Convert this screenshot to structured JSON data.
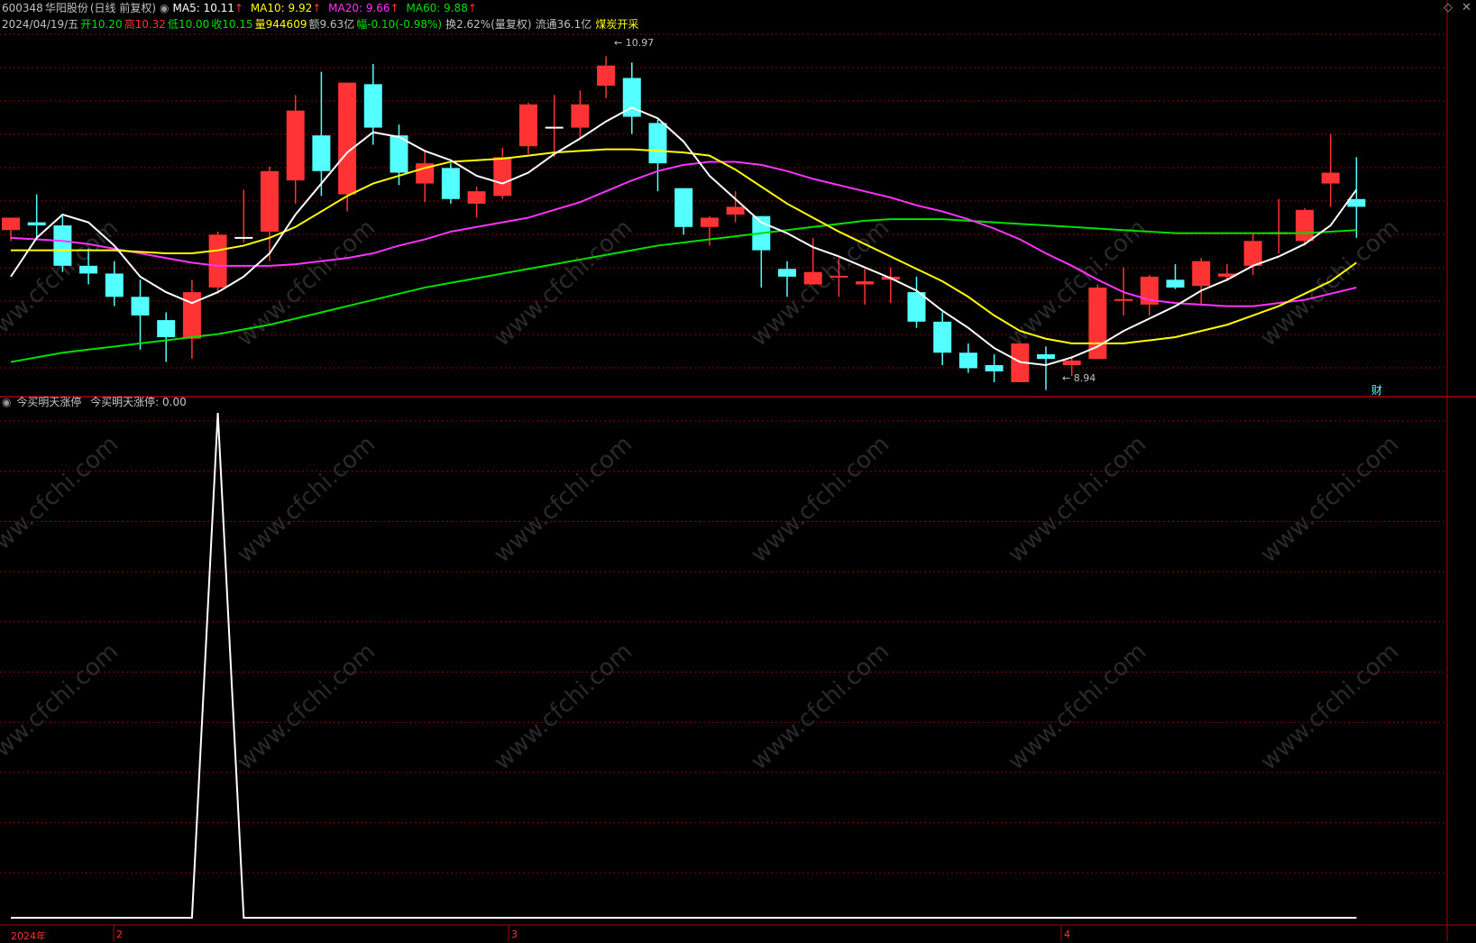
{
  "header": {
    "code": "600348",
    "name": "华阳股份",
    "period": "(日线 前复权)",
    "ma5_label": "MA5: 10.11",
    "ma10_label": "MA10: 9.92",
    "ma20_label": "MA20: 9.66",
    "ma60_label": "MA60: 9.88",
    "arrow": "↑"
  },
  "quote": {
    "date": "2024/04/19/五",
    "open": "开10.20",
    "high": "高10.32",
    "low": "低10.00",
    "close": "收10.15",
    "volume": "量944609",
    "amount": "额9.63亿",
    "change": "幅-0.10(-0.98%)",
    "turnover": "换2.62%(量复权)",
    "float": "流通36.1亿",
    "concept": "煤炭开采"
  },
  "indicator": {
    "name": "今买明天涨停",
    "value_label": "今买明天涨停: 0.00"
  },
  "annotations": {
    "high_marker": "10.97",
    "low_marker": "8.94",
    "finance_badge": "财"
  },
  "x_axis": {
    "year": "2024年",
    "m2": "2",
    "m3": "3",
    "m4": "4"
  },
  "colors": {
    "up": "#ff3333",
    "down": "#54ffff",
    "ma5": "#ffffff",
    "ma10": "#ffff00",
    "ma20": "#ff33ff",
    "ma60": "#00e000",
    "grid": "#8b0000"
  },
  "chart_data": {
    "type": "candlestick",
    "price_range": [
      8.8,
      11.1
    ],
    "indicator_range": [
      0,
      1
    ],
    "candles": [
      {
        "o": 9.85,
        "c": 9.93,
        "h": 9.93,
        "l": 9.78
      },
      {
        "o": 9.9,
        "c": 9.88,
        "h": 10.08,
        "l": 9.8
      },
      {
        "o": 9.88,
        "c": 9.62,
        "h": 9.94,
        "l": 9.58
      },
      {
        "o": 9.62,
        "c": 9.57,
        "h": 9.73,
        "l": 9.5
      },
      {
        "o": 9.57,
        "c": 9.42,
        "h": 9.65,
        "l": 9.36
      },
      {
        "o": 9.42,
        "c": 9.3,
        "h": 9.53,
        "l": 9.08
      },
      {
        "o": 9.27,
        "c": 9.16,
        "h": 9.32,
        "l": 9.0
      },
      {
        "o": 9.15,
        "c": 9.45,
        "h": 9.53,
        "l": 9.02
      },
      {
        "o": 9.48,
        "c": 9.82,
        "h": 9.84,
        "l": 9.44
      },
      {
        "o": 9.8,
        "c": 9.8,
        "h": 10.11,
        "l": 9.77
      },
      {
        "o": 9.84,
        "c": 10.23,
        "h": 10.26,
        "l": 9.65
      },
      {
        "o": 10.17,
        "c": 10.62,
        "h": 10.72,
        "l": 10.02
      },
      {
        "o": 10.46,
        "c": 10.23,
        "h": 10.87,
        "l": 10.07
      },
      {
        "o": 10.08,
        "c": 10.8,
        "h": 10.8,
        "l": 9.97
      },
      {
        "o": 10.79,
        "c": 10.51,
        "h": 10.92,
        "l": 10.4
      },
      {
        "o": 10.46,
        "c": 10.22,
        "h": 10.53,
        "l": 10.14
      },
      {
        "o": 10.15,
        "c": 10.28,
        "h": 10.36,
        "l": 10.03
      },
      {
        "o": 10.25,
        "c": 10.05,
        "h": 10.28,
        "l": 10.02
      },
      {
        "o": 10.02,
        "c": 10.1,
        "h": 10.13,
        "l": 9.93
      },
      {
        "o": 10.07,
        "c": 10.32,
        "h": 10.38,
        "l": 10.05
      },
      {
        "o": 10.39,
        "c": 10.66,
        "h": 10.67,
        "l": 10.34
      },
      {
        "o": 10.51,
        "c": 10.51,
        "h": 10.72,
        "l": 10.32
      },
      {
        "o": 10.51,
        "c": 10.66,
        "h": 10.75,
        "l": 10.44
      },
      {
        "o": 10.78,
        "c": 10.91,
        "h": 10.97,
        "l": 10.7
      },
      {
        "o": 10.83,
        "c": 10.58,
        "h": 10.93,
        "l": 10.47
      },
      {
        "o": 10.54,
        "c": 10.28,
        "h": 10.56,
        "l": 10.1
      },
      {
        "o": 10.12,
        "c": 9.87,
        "h": 10.12,
        "l": 9.82
      },
      {
        "o": 9.87,
        "c": 9.93,
        "h": 9.94,
        "l": 9.75
      },
      {
        "o": 9.95,
        "c": 10.0,
        "h": 10.1,
        "l": 9.9
      },
      {
        "o": 9.94,
        "c": 9.72,
        "h": 9.94,
        "l": 9.48
      },
      {
        "o": 9.6,
        "c": 9.55,
        "h": 9.65,
        "l": 9.42
      },
      {
        "o": 9.5,
        "c": 9.58,
        "h": 9.8,
        "l": 9.5
      },
      {
        "o": 9.55,
        "c": 9.55,
        "h": 9.67,
        "l": 9.42
      },
      {
        "o": 9.5,
        "c": 9.52,
        "h": 9.6,
        "l": 9.37
      },
      {
        "o": 9.53,
        "c": 9.55,
        "h": 9.61,
        "l": 9.38
      },
      {
        "o": 9.45,
        "c": 9.26,
        "h": 9.55,
        "l": 9.22
      },
      {
        "o": 9.26,
        "c": 9.06,
        "h": 9.32,
        "l": 8.98
      },
      {
        "o": 9.06,
        "c": 8.96,
        "h": 9.12,
        "l": 8.93
      },
      {
        "o": 8.98,
        "c": 8.94,
        "h": 9.05,
        "l": 8.87
      },
      {
        "o": 8.87,
        "c": 9.12,
        "h": 9.12,
        "l": 8.87
      },
      {
        "o": 9.05,
        "c": 9.02,
        "h": 9.1,
        "l": 8.82
      },
      {
        "o": 8.98,
        "c": 9.01,
        "h": 9.04,
        "l": 8.91
      },
      {
        "o": 9.02,
        "c": 9.48,
        "h": 9.5,
        "l": 9.02
      },
      {
        "o": 9.4,
        "c": 9.4,
        "h": 9.61,
        "l": 9.3
      },
      {
        "o": 9.37,
        "c": 9.55,
        "h": 9.56,
        "l": 9.3
      },
      {
        "o": 9.53,
        "c": 9.48,
        "h": 9.63,
        "l": 9.47
      },
      {
        "o": 9.49,
        "c": 9.65,
        "h": 9.67,
        "l": 9.37
      },
      {
        "o": 9.55,
        "c": 9.57,
        "h": 9.63,
        "l": 9.52
      },
      {
        "o": 9.62,
        "c": 9.78,
        "h": 9.83,
        "l": 9.56
      },
      {
        "o": 9.83,
        "c": 9.83,
        "h": 10.05,
        "l": 9.7
      },
      {
        "o": 9.78,
        "c": 9.98,
        "h": 9.99,
        "l": 9.75
      },
      {
        "o": 10.15,
        "c": 10.22,
        "h": 10.47,
        "l": 10.0
      },
      {
        "o": 10.05,
        "c": 10.0,
        "h": 10.32,
        "l": 9.8
      }
    ],
    "ma5": [
      9.55,
      9.8,
      9.95,
      9.9,
      9.75,
      9.55,
      9.45,
      9.38,
      9.45,
      9.55,
      9.7,
      9.95,
      10.15,
      10.35,
      10.48,
      10.45,
      10.36,
      10.3,
      10.2,
      10.15,
      10.22,
      10.34,
      10.44,
      10.55,
      10.64,
      10.57,
      10.42,
      10.2,
      10.05,
      9.9,
      9.83,
      9.74,
      9.68,
      9.61,
      9.54,
      9.46,
      9.33,
      9.22,
      9.09,
      9.0,
      8.98,
      9.03,
      9.1,
      9.2,
      9.28,
      9.36,
      9.46,
      9.53,
      9.62,
      9.68,
      9.76,
      9.88,
      10.11
    ],
    "ma10": [
      9.72,
      9.72,
      9.72,
      9.72,
      9.72,
      9.71,
      9.7,
      9.7,
      9.72,
      9.75,
      9.8,
      9.87,
      9.97,
      10.07,
      10.15,
      10.2,
      10.25,
      10.29,
      10.3,
      10.31,
      10.33,
      10.35,
      10.36,
      10.37,
      10.37,
      10.36,
      10.35,
      10.33,
      10.24,
      10.13,
      10.02,
      9.93,
      9.84,
      9.76,
      9.68,
      9.6,
      9.52,
      9.42,
      9.3,
      9.2,
      9.15,
      9.12,
      9.12,
      9.12,
      9.14,
      9.16,
      9.2,
      9.24,
      9.3,
      9.36,
      9.44,
      9.52,
      9.64
    ],
    "ma20": [
      9.8,
      9.79,
      9.78,
      9.76,
      9.73,
      9.7,
      9.67,
      9.64,
      9.62,
      9.62,
      9.62,
      9.63,
      9.65,
      9.67,
      9.7,
      9.75,
      9.79,
      9.84,
      9.87,
      9.9,
      9.93,
      9.98,
      10.03,
      10.1,
      10.17,
      10.23,
      10.27,
      10.29,
      10.29,
      10.27,
      10.23,
      10.18,
      10.14,
      10.1,
      10.06,
      10.01,
      9.97,
      9.92,
      9.86,
      9.79,
      9.7,
      9.62,
      9.53,
      9.45,
      9.4,
      9.38,
      9.37,
      9.36,
      9.36,
      9.38,
      9.4,
      9.44,
      9.48
    ],
    "ma60": [
      9.0,
      9.03,
      9.06,
      9.08,
      9.1,
      9.12,
      9.14,
      9.16,
      9.18,
      9.21,
      9.24,
      9.28,
      9.32,
      9.36,
      9.4,
      9.44,
      9.48,
      9.51,
      9.54,
      9.57,
      9.6,
      9.63,
      9.66,
      9.69,
      9.72,
      9.75,
      9.77,
      9.79,
      9.81,
      9.83,
      9.85,
      9.87,
      9.89,
      9.91,
      9.92,
      9.92,
      9.92,
      9.91,
      9.9,
      9.89,
      9.88,
      9.87,
      9.86,
      9.85,
      9.84,
      9.83,
      9.83,
      9.83,
      9.83,
      9.83,
      9.83,
      9.84,
      9.85
    ],
    "indicator": [
      0,
      0,
      0,
      0,
      0,
      0,
      0,
      0,
      1,
      0,
      0,
      0,
      0,
      0,
      0,
      0,
      0,
      0,
      0,
      0,
      0,
      0,
      0,
      0,
      0,
      0,
      0,
      0,
      0,
      0,
      0,
      0,
      0,
      0,
      0,
      0,
      0,
      0,
      0,
      0,
      0,
      0,
      0,
      0,
      0,
      0,
      0,
      0,
      0,
      0,
      0,
      0,
      0
    ]
  }
}
